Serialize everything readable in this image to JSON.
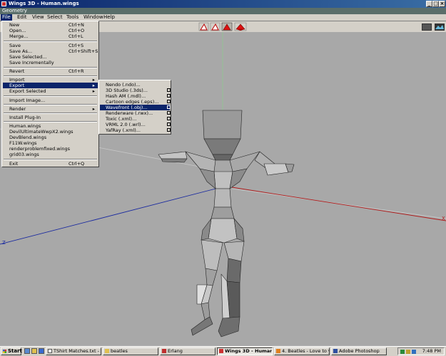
{
  "window": {
    "title": "Wings 3D - Human.wings",
    "mode": "Geometry"
  },
  "menubar": [
    "File",
    "Edit",
    "View",
    "Select",
    "Tools",
    "Window",
    "Help"
  ],
  "file_menu": [
    {
      "label": "New",
      "shortcut": "Ctrl+N"
    },
    {
      "label": "Open...",
      "shortcut": "Ctrl+O"
    },
    {
      "label": "Merge...",
      "shortcut": "Ctrl+L"
    },
    {
      "label": "Save",
      "shortcut": "Ctrl+S"
    },
    {
      "label": "Save As...",
      "shortcut": "Ctrl+Shift+S"
    },
    {
      "label": "Save Selected...",
      "shortcut": ""
    },
    {
      "label": "Save Incrementally",
      "shortcut": ""
    },
    {
      "label": "Revert",
      "shortcut": "Ctrl+R"
    },
    {
      "label": "Import",
      "shortcut": ""
    },
    {
      "label": "Export",
      "shortcut": ""
    },
    {
      "label": "Export Selected",
      "shortcut": ""
    },
    {
      "label": "Import Image...",
      "shortcut": ""
    },
    {
      "label": "Render",
      "shortcut": ""
    },
    {
      "label": "Install Plug-In",
      "shortcut": ""
    },
    {
      "label": "Human.wings",
      "shortcut": ""
    },
    {
      "label": "DevilUltimateWwpX2.wings",
      "shortcut": ""
    },
    {
      "label": "DevBlend.wings",
      "shortcut": ""
    },
    {
      "label": "F11W.wings",
      "shortcut": ""
    },
    {
      "label": "renderproblemfixed.wings",
      "shortcut": ""
    },
    {
      "label": "grid03.wings",
      "shortcut": ""
    },
    {
      "label": "Exit",
      "shortcut": "Ctrl+Q"
    }
  ],
  "export_menu": [
    {
      "label": "Nendo (.ndo)..."
    },
    {
      "label": "3D Studio (.3ds)..."
    },
    {
      "label": "Hash AM (.mdl)..."
    },
    {
      "label": "Cartoon edges (.eps)..."
    },
    {
      "label": "Wavefront (.obj)..."
    },
    {
      "label": "Renderware (.rwx)..."
    },
    {
      "label": "Toxic (.xml)..."
    },
    {
      "label": "VRML 2.0 (.wrl)..."
    },
    {
      "label": "YafRay (.xml)..."
    }
  ],
  "axes": {
    "x_label": "X",
    "z_label": "Z"
  },
  "taskbar": {
    "start": "Start",
    "tasks": [
      "TShirt Matches.txt - Note...",
      "beatles",
      "Erlang",
      "Wings 3D - Human.win...",
      "4. Beatles - Love to you -...",
      "Adobe Photoshop"
    ],
    "clock": "7:48 PM"
  },
  "colors": {
    "title": "#0a246a",
    "selection": "#0a246a",
    "viewport": "#a8a8a8"
  }
}
